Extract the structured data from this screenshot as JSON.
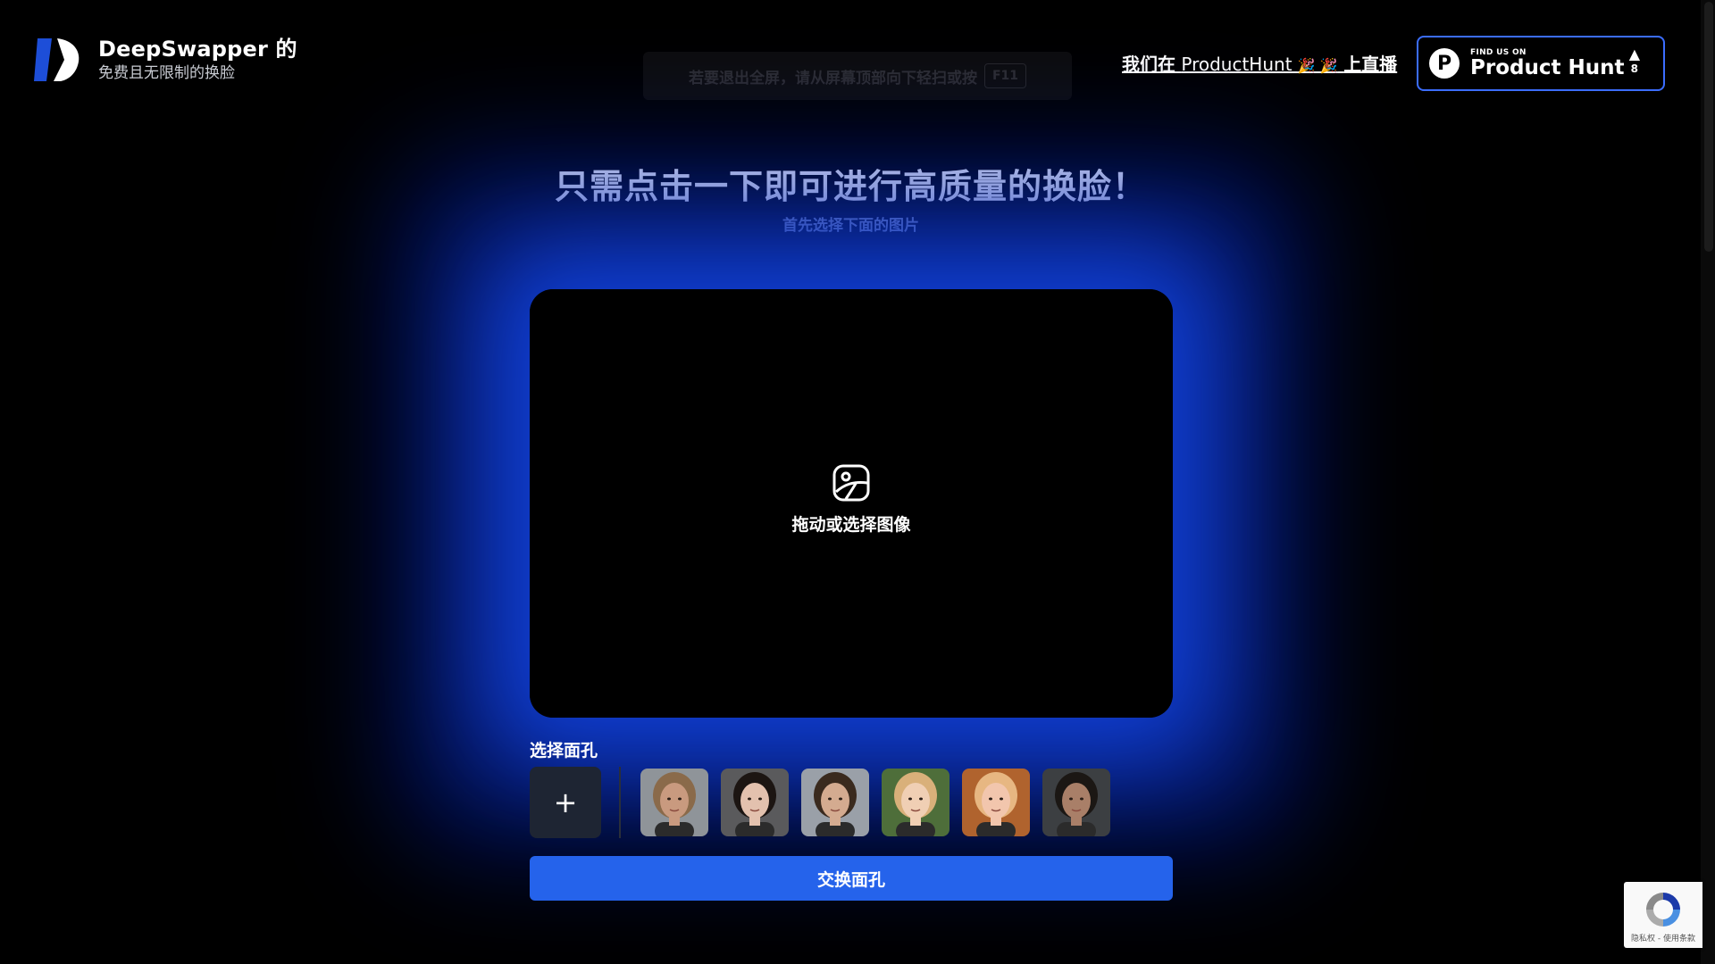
{
  "brand": {
    "title": "DeepSwapper 的",
    "subtitle": "免费且无限制的换脸"
  },
  "fullscreen_hint": {
    "text": "若要退出全屏，请从屏幕顶部向下轻扫或按",
    "key": "F11"
  },
  "producthunt_link": {
    "prefix": "我们在",
    "name": "ProductHunt",
    "emoji": "🎉 🎉",
    "suffix": "上直播"
  },
  "producthunt_badge": {
    "find_us": "FIND US ON",
    "name": "Product Hunt",
    "upvotes": "8"
  },
  "hero": {
    "title": "只需点击一下即可进行高质量的换脸！",
    "subtitle": "首先选择下面的图片"
  },
  "dropzone": {
    "label": "拖动或选择图像"
  },
  "faces": {
    "label": "选择面孔",
    "add_label": "+",
    "items": [
      {
        "name": "face-1",
        "skin": "#c99a7f",
        "hair": "#8a6a4a",
        "bg": "#8f9499"
      },
      {
        "name": "face-2",
        "skin": "#e3c1ae",
        "hair": "#1c1512",
        "bg": "#5a5a5c"
      },
      {
        "name": "face-3",
        "skin": "#d4ab90",
        "hair": "#3a2a1e",
        "bg": "#9aa0a8"
      },
      {
        "name": "face-4",
        "skin": "#f0cfb4",
        "hair": "#d9b07a",
        "bg": "#4e6e3a"
      },
      {
        "name": "face-5",
        "skin": "#f2c6ad",
        "hair": "#e7b782",
        "bg": "#b0632e"
      },
      {
        "name": "face-6",
        "skin": "#a97f68",
        "hair": "#1b1714",
        "bg": "#3c3f42"
      }
    ]
  },
  "swap_button": {
    "label": "交换面孔"
  },
  "recaptcha": {
    "text": "隐私权 - 使用条款"
  },
  "colors": {
    "accent": "#2563eb",
    "glow": "#1446e6",
    "badge_border": "#3b6dff"
  }
}
